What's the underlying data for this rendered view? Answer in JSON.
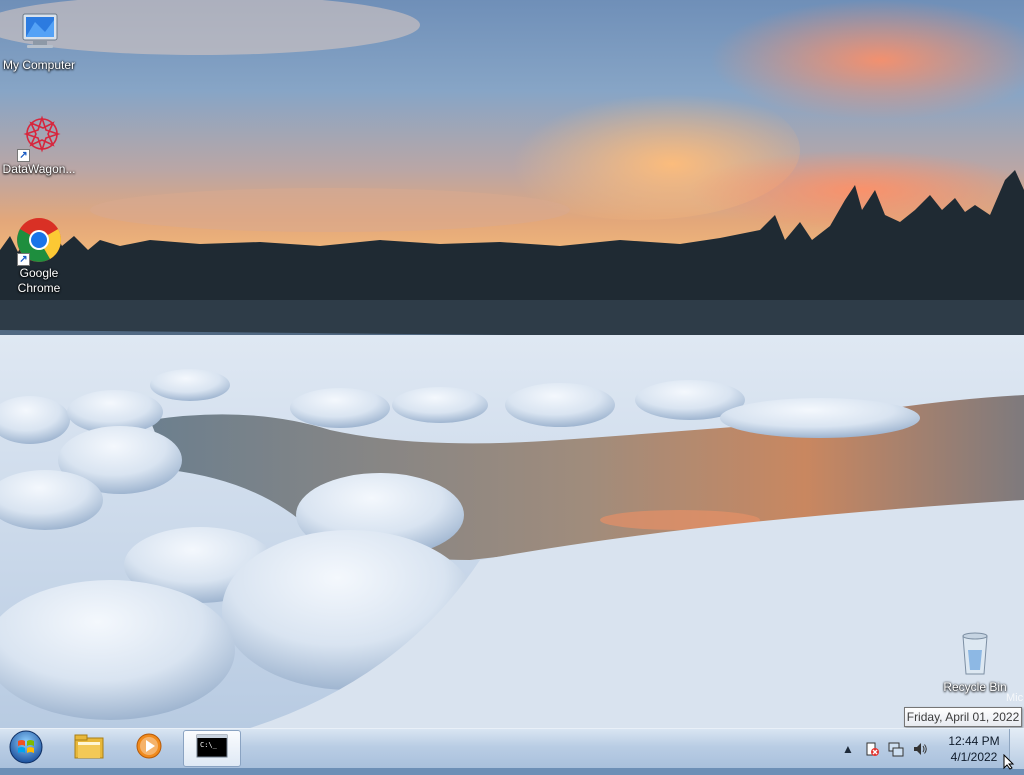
{
  "desktop": {
    "icons": [
      {
        "label": "My Computer",
        "icon": "computer-icon"
      },
      {
        "label": "DataWagon...",
        "icon": "datawagon-icon"
      },
      {
        "label": "Google Chrome",
        "icon": "chrome-icon"
      },
      {
        "label": "Recycle Bin",
        "icon": "recycle-bin-icon"
      }
    ],
    "watermark": "Mic"
  },
  "taskbar": {
    "start_icon": "windows-logo-icon",
    "pinned": [
      {
        "name": "Windows Explorer",
        "icon": "folder-icon"
      },
      {
        "name": "Windows Media Player",
        "icon": "media-player-icon"
      },
      {
        "name": "Command Prompt",
        "icon": "cmd-icon",
        "active": true
      }
    ],
    "tray": {
      "icons": [
        "show-hidden-icons-icon",
        "action-center-icon",
        "network-icon",
        "volume-icon"
      ],
      "time": "12:44 PM",
      "date": "4/1/2022"
    }
  },
  "tooltip": {
    "text": "Friday, April 01, 2022"
  },
  "colors": {
    "taskbar": "#b9cde4",
    "tooltip_border": "#767676"
  }
}
